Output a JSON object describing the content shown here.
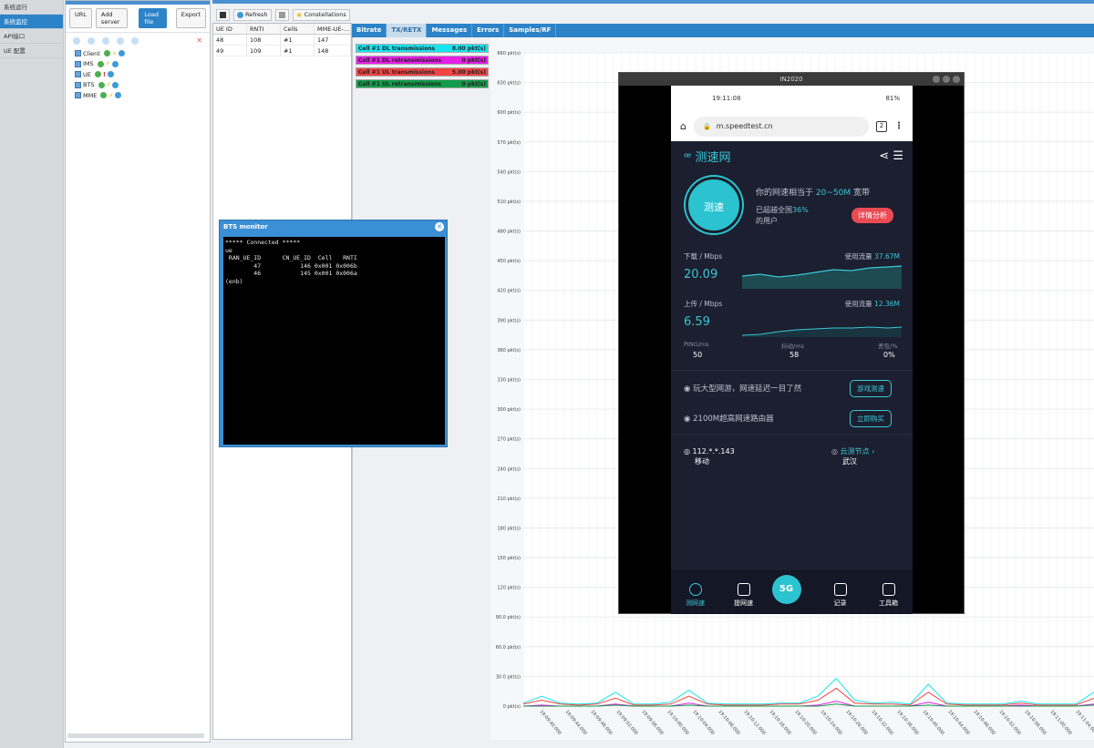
{
  "leftnav": {
    "items": [
      {
        "label": "系统运行"
      },
      {
        "label": "系统监控"
      },
      {
        "label": "API接口"
      },
      {
        "label": "UE 配置"
      }
    ]
  },
  "server_panel": {
    "buttons": {
      "url": "URL",
      "add_server": "Add server",
      "load_file": "Load file",
      "export": "Export"
    },
    "tree": [
      {
        "name": "Client"
      },
      {
        "name": "IMS"
      },
      {
        "name": "UE"
      },
      {
        "name": "BTS"
      },
      {
        "name": "MME"
      }
    ]
  },
  "toolbar": {
    "refresh": "Refresh",
    "constellations": "Constellations"
  },
  "ue_table": {
    "headers": [
      "UE ID",
      "RNTI",
      "Cells",
      "MME-UE-…"
    ],
    "rows": [
      [
        "48",
        "108",
        "#1",
        "147"
      ],
      [
        "49",
        "109",
        "#1",
        "148"
      ]
    ]
  },
  "tabs": [
    "Bitrate",
    "TX/RETX",
    "Messages",
    "Errors",
    "Samples/RF"
  ],
  "legend": [
    {
      "label": "Cell #1 DL transmissions",
      "value": "8.00 pkt(s)",
      "color": "#17e4f0"
    },
    {
      "label": "Cell #1 DL retransmissions",
      "value": "0 pkt(s)",
      "color": "#e61ee6"
    },
    {
      "label": "Cell #1 UL transmissions",
      "value": "5.00 pkt(s)",
      "color": "#f44444"
    },
    {
      "label": "Cell #1 UL retransmissions",
      "value": "0 pkt(s)",
      "color": "#129b4a"
    }
  ],
  "chart_data": {
    "type": "line",
    "ylabel_unit": "pkt(s)",
    "ylim": [
      0,
      660
    ],
    "yticks": [
      "660 pkt(s)",
      "630 pkt(s)",
      "600 pkt(s)",
      "570 pkt(s)",
      "540 pkt(s)",
      "510 pkt(s)",
      "480 pkt(s)",
      "450 pkt(s)",
      "420 pkt(s)",
      "390 pkt(s)",
      "360 pkt(s)",
      "330 pkt(s)",
      "300 pkt(s)",
      "270 pkt(s)",
      "240 pkt(s)",
      "210 pkt(s)",
      "180 pkt(s)",
      "150 pkt(s)",
      "120 pkt(s)",
      "90.0 pkt(s)",
      "60.0 pkt(s)",
      "30.0 pkt(s)",
      "0 pkt(s)"
    ],
    "xticks": [
      "19:09:40.000",
      "19:09:44.000",
      "19:09:48.000",
      "19:09:52.000",
      "19:09:56.000",
      "19:10:00.000",
      "19:10:04.000",
      "19:10:08.000",
      "19:10:12.000",
      "19:10:16.000",
      "19:10:20.000",
      "19:10:24.000",
      "19:10:28.000",
      "19:10:32.000",
      "19:10:36.000",
      "19:10:40.000",
      "19:10:44.000",
      "19:10:48.000",
      "19:10:52.000",
      "19:10:56.000",
      "19:11:00.000",
      "19:11:04.000"
    ],
    "series": [
      {
        "name": "Cell #1 DL transmissions",
        "values": [
          3,
          10,
          3,
          2,
          3,
          14,
          2,
          2,
          4,
          16,
          3,
          2,
          2,
          2,
          3,
          3,
          10,
          28,
          6,
          3,
          4,
          2,
          22,
          3,
          2,
          2,
          2,
          5,
          2,
          2,
          2,
          14
        ]
      },
      {
        "name": "Cell #1 UL transmissions",
        "values": [
          2,
          6,
          2,
          1,
          2,
          8,
          1,
          1,
          2,
          10,
          2,
          1,
          1,
          1,
          2,
          2,
          6,
          18,
          3,
          2,
          2,
          1,
          14,
          2,
          1,
          1,
          1,
          3,
          1,
          1,
          1,
          8
        ]
      },
      {
        "name": "Cell #1 DL retransmissions",
        "values": [
          0,
          1,
          0,
          0,
          0,
          2,
          0,
          0,
          0,
          3,
          0,
          0,
          0,
          0,
          0,
          0,
          1,
          5,
          0,
          0,
          0,
          0,
          4,
          0,
          0,
          0,
          0,
          1,
          0,
          0,
          0,
          2
        ]
      },
      {
        "name": "Cell #1 UL retransmissions",
        "values": [
          0,
          0,
          0,
          0,
          0,
          1,
          0,
          0,
          0,
          1,
          0,
          0,
          0,
          0,
          0,
          0,
          0,
          2,
          0,
          0,
          0,
          0,
          1,
          0,
          0,
          0,
          0,
          0,
          0,
          0,
          0,
          1
        ]
      }
    ]
  },
  "bts_monitor": {
    "title": "BTS monitor",
    "terminal": "***** Connected *****\nue\n RAN_UE_ID      CN_UE_ID  Cell   RNTI\n        47           146 0x001 0x006b\n        46           145 0x001 0x006a\n(enb)"
  },
  "phone_window": {
    "title": "IN2020",
    "status": {
      "time": "19:11:08",
      "battery": "81%"
    },
    "url": "m.speedtest.cn",
    "tab_count": "2",
    "app_title": "测速网",
    "test_button": "测速",
    "rate_text_1": "你的网速相当于",
    "rate_value": "20~50M",
    "rate_text_2": "宽带",
    "beat_text_1": "已超越全国",
    "beat_value": "36%",
    "beat_text_2": "的用户",
    "detail_button": "详情分析",
    "download": {
      "label": "下载 / Mbps",
      "value": "20.09",
      "usage_label": "使用流量",
      "usage_value": "37.67M"
    },
    "upload": {
      "label": "上传 / Mbps",
      "value": "6.59",
      "usage_label": "使用流量",
      "usage_value": "12.36M"
    },
    "ping": {
      "label": "PING/ms",
      "value": "50"
    },
    "jitter": {
      "label": "抖动/ms",
      "value": "58"
    },
    "loss": {
      "label": "丢包/%",
      "value": "0%"
    },
    "promo1": {
      "text": "玩大型网游，网速延迟一目了然",
      "button": "游戏测速"
    },
    "promo2": {
      "text": "2100M超高网速路由器",
      "button": "立即购买"
    },
    "ip": "112.*.*.143",
    "carrier": "移动",
    "node_label": "云测节点",
    "node_city": "武汉",
    "bottom_nav": [
      "测网速",
      "提网速",
      "5G",
      "记录",
      "工具箱"
    ]
  }
}
